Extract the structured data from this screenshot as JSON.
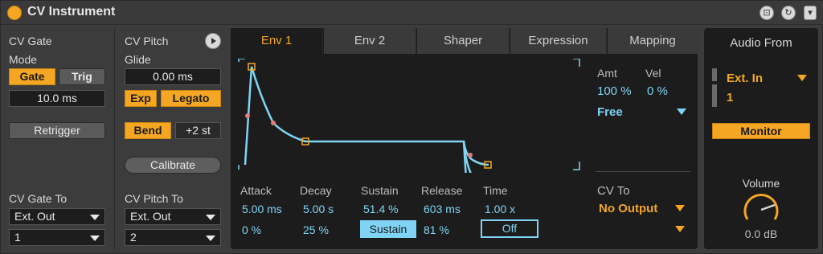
{
  "window": {
    "title": "CV Instrument"
  },
  "cv_gate": {
    "header": "CV Gate",
    "mode_label": "Mode",
    "gate_label": "Gate",
    "trig_label": "Trig",
    "time_value": "10.0 ms",
    "retrigger_label": "Retrigger",
    "to_label": "CV Gate To",
    "to_value": "Ext. Out",
    "channel_value": "1"
  },
  "cv_pitch": {
    "header": "CV Pitch",
    "glide_label": "Glide",
    "glide_value": "0.00 ms",
    "exp_label": "Exp",
    "legato_label": "Legato",
    "bend_label": "Bend",
    "bend_range": "+2 st",
    "calibrate_label": "Calibrate",
    "to_label": "CV Pitch To",
    "to_value": "Ext. Out",
    "channel_value": "2"
  },
  "tabs": [
    "Env 1",
    "Env 2",
    "Shaper",
    "Expression",
    "Mapping"
  ],
  "active_tab": "Env 1",
  "envelope": {
    "amt_label": "Amt",
    "vel_label": "Vel",
    "amt_value": "100 %",
    "vel_value": "0 %",
    "mode_value": "Free",
    "attack_label": "Attack",
    "decay_label": "Decay",
    "sustain_label": "Sustain",
    "release_label": "Release",
    "time_label": "Time",
    "attack_value": "5.00 ms",
    "decay_value": "5.00 s",
    "sustain_value": "51.4 %",
    "release_value": "603 ms",
    "time_value": "1.00 x",
    "attack_slope": "0 %",
    "decay_slope": "25 %",
    "sustain_button": "Sustain",
    "release_slope": "81 %",
    "loop_value": "Off",
    "cv_to_label": "CV To",
    "cv_to_value": "No Output"
  },
  "audio": {
    "header": "Audio From",
    "input_value": "Ext. In",
    "channel_value": "1",
    "monitor_label": "Monitor",
    "volume_label": "Volume",
    "volume_value": "0.0 dB"
  },
  "colors": {
    "accent": "#f5a623",
    "envelope_line": "#7fd4f5",
    "panel_bg": "#1c1c1c"
  }
}
